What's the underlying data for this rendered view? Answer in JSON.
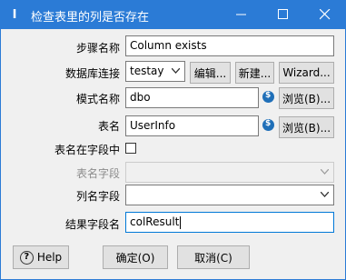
{
  "window": {
    "title": "检查表里的列是否存在",
    "app_icon": "I"
  },
  "form": {
    "step_name_label": "步骤名称",
    "step_name_value": "Column exists",
    "connection_label": "数据库连接",
    "connection_value": "testay",
    "edit_button": "编辑...",
    "new_button": "新建...",
    "wizard_button": "Wizard...",
    "schema_label": "模式名称",
    "schema_value": "dbo",
    "browse_schema_button": "浏览(B)...",
    "table_label": "表名",
    "table_value": "UserInfo",
    "browse_table_button": "浏览(B)...",
    "table_in_field_label": "表名在字段中",
    "table_in_field_checked": false,
    "table_field_label": "表名字段",
    "table_field_value": "",
    "column_field_label": "列名字段",
    "column_field_value": "",
    "result_field_label": "结果字段名",
    "result_field_value": "colResult"
  },
  "footer": {
    "help_button": "Help",
    "ok_button": "确定(O)",
    "cancel_button": "取消(C)"
  },
  "colors": {
    "titlebar": "#2b7bd6",
    "focus_border": "#0078d7",
    "variable_icon": "#1f6fb8"
  }
}
